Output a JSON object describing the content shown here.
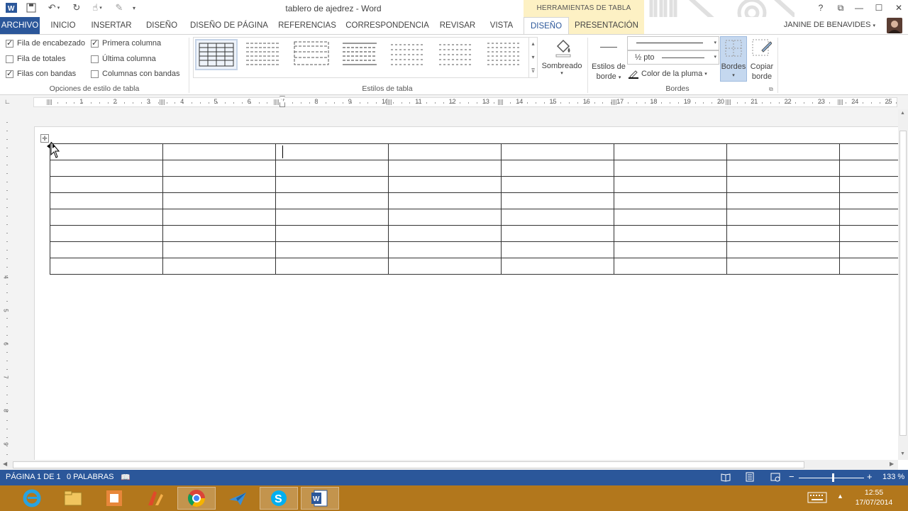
{
  "titlebar": {
    "document_title": "tablero de ajedrez - Word",
    "contextual_group": "HERRAMIENTAS DE TABLA",
    "help": "?",
    "restore": "⧉",
    "minimize": "—",
    "maximize": "☐",
    "close": "✕"
  },
  "tabs": {
    "archivo": "ARCHIVO",
    "inicio": "INICIO",
    "insertar": "INSERTAR",
    "diseno": "DISEÑO",
    "diseno_pagina": "DISEÑO DE PÁGINA",
    "referencias": "REFERENCIAS",
    "correspondencia": "CORRESPONDENCIA",
    "revisar": "REVISAR",
    "vista": "VISTA",
    "diseno_ctx": "DISEÑO",
    "presentacion": "PRESENTACIÓN"
  },
  "user": {
    "name": "JANINE DE BENAVIDES"
  },
  "ribbon": {
    "style_options": {
      "header_row": {
        "label": "Fila de encabezado",
        "checked": true
      },
      "total_row": {
        "label": "Fila de totales",
        "checked": false
      },
      "banded_rows": {
        "label": "Filas con bandas",
        "checked": true
      },
      "first_column": {
        "label": "Primera columna",
        "checked": true
      },
      "last_column": {
        "label": "Última columna",
        "checked": false
      },
      "banded_columns": {
        "label": "Columnas con bandas",
        "checked": false
      },
      "group_label": "Opciones de estilo de tabla"
    },
    "table_styles": {
      "group_label": "Estilos de tabla"
    },
    "shading": {
      "label": "Sombreado"
    },
    "borders": {
      "border_styles_label_1": "Estilos de",
      "border_styles_label_2": "borde",
      "line_weight": "½ pto",
      "pen_color": "Color de la pluma",
      "borders_button": "Bordes",
      "copy_border_1": "Copiar",
      "copy_border_2": "borde",
      "group_label": "Bordes"
    }
  },
  "ruler": {
    "numbers": [
      "1",
      "2",
      "3",
      "4",
      "5",
      "6",
      "7",
      "8",
      "9",
      "10",
      "11",
      "12",
      "13",
      "14",
      "15",
      "16",
      "17",
      "18",
      "19",
      "20",
      "21",
      "22",
      "23",
      "24",
      "25"
    ]
  },
  "vruler_numbers": [
    "4",
    "5",
    "6",
    "7",
    "8",
    "9"
  ],
  "table": {
    "rows": 8,
    "cols": 8
  },
  "statusbar": {
    "page": "PÁGINA 1 DE 1",
    "words": "0 PALABRAS",
    "zoom": "133 %"
  },
  "taskbar": {
    "time": "12:55",
    "date": "17/07/2014"
  },
  "colors": {
    "accent": "#2b579a",
    "contextual": "#fdf1c4",
    "taskbar": "#b2771c"
  }
}
